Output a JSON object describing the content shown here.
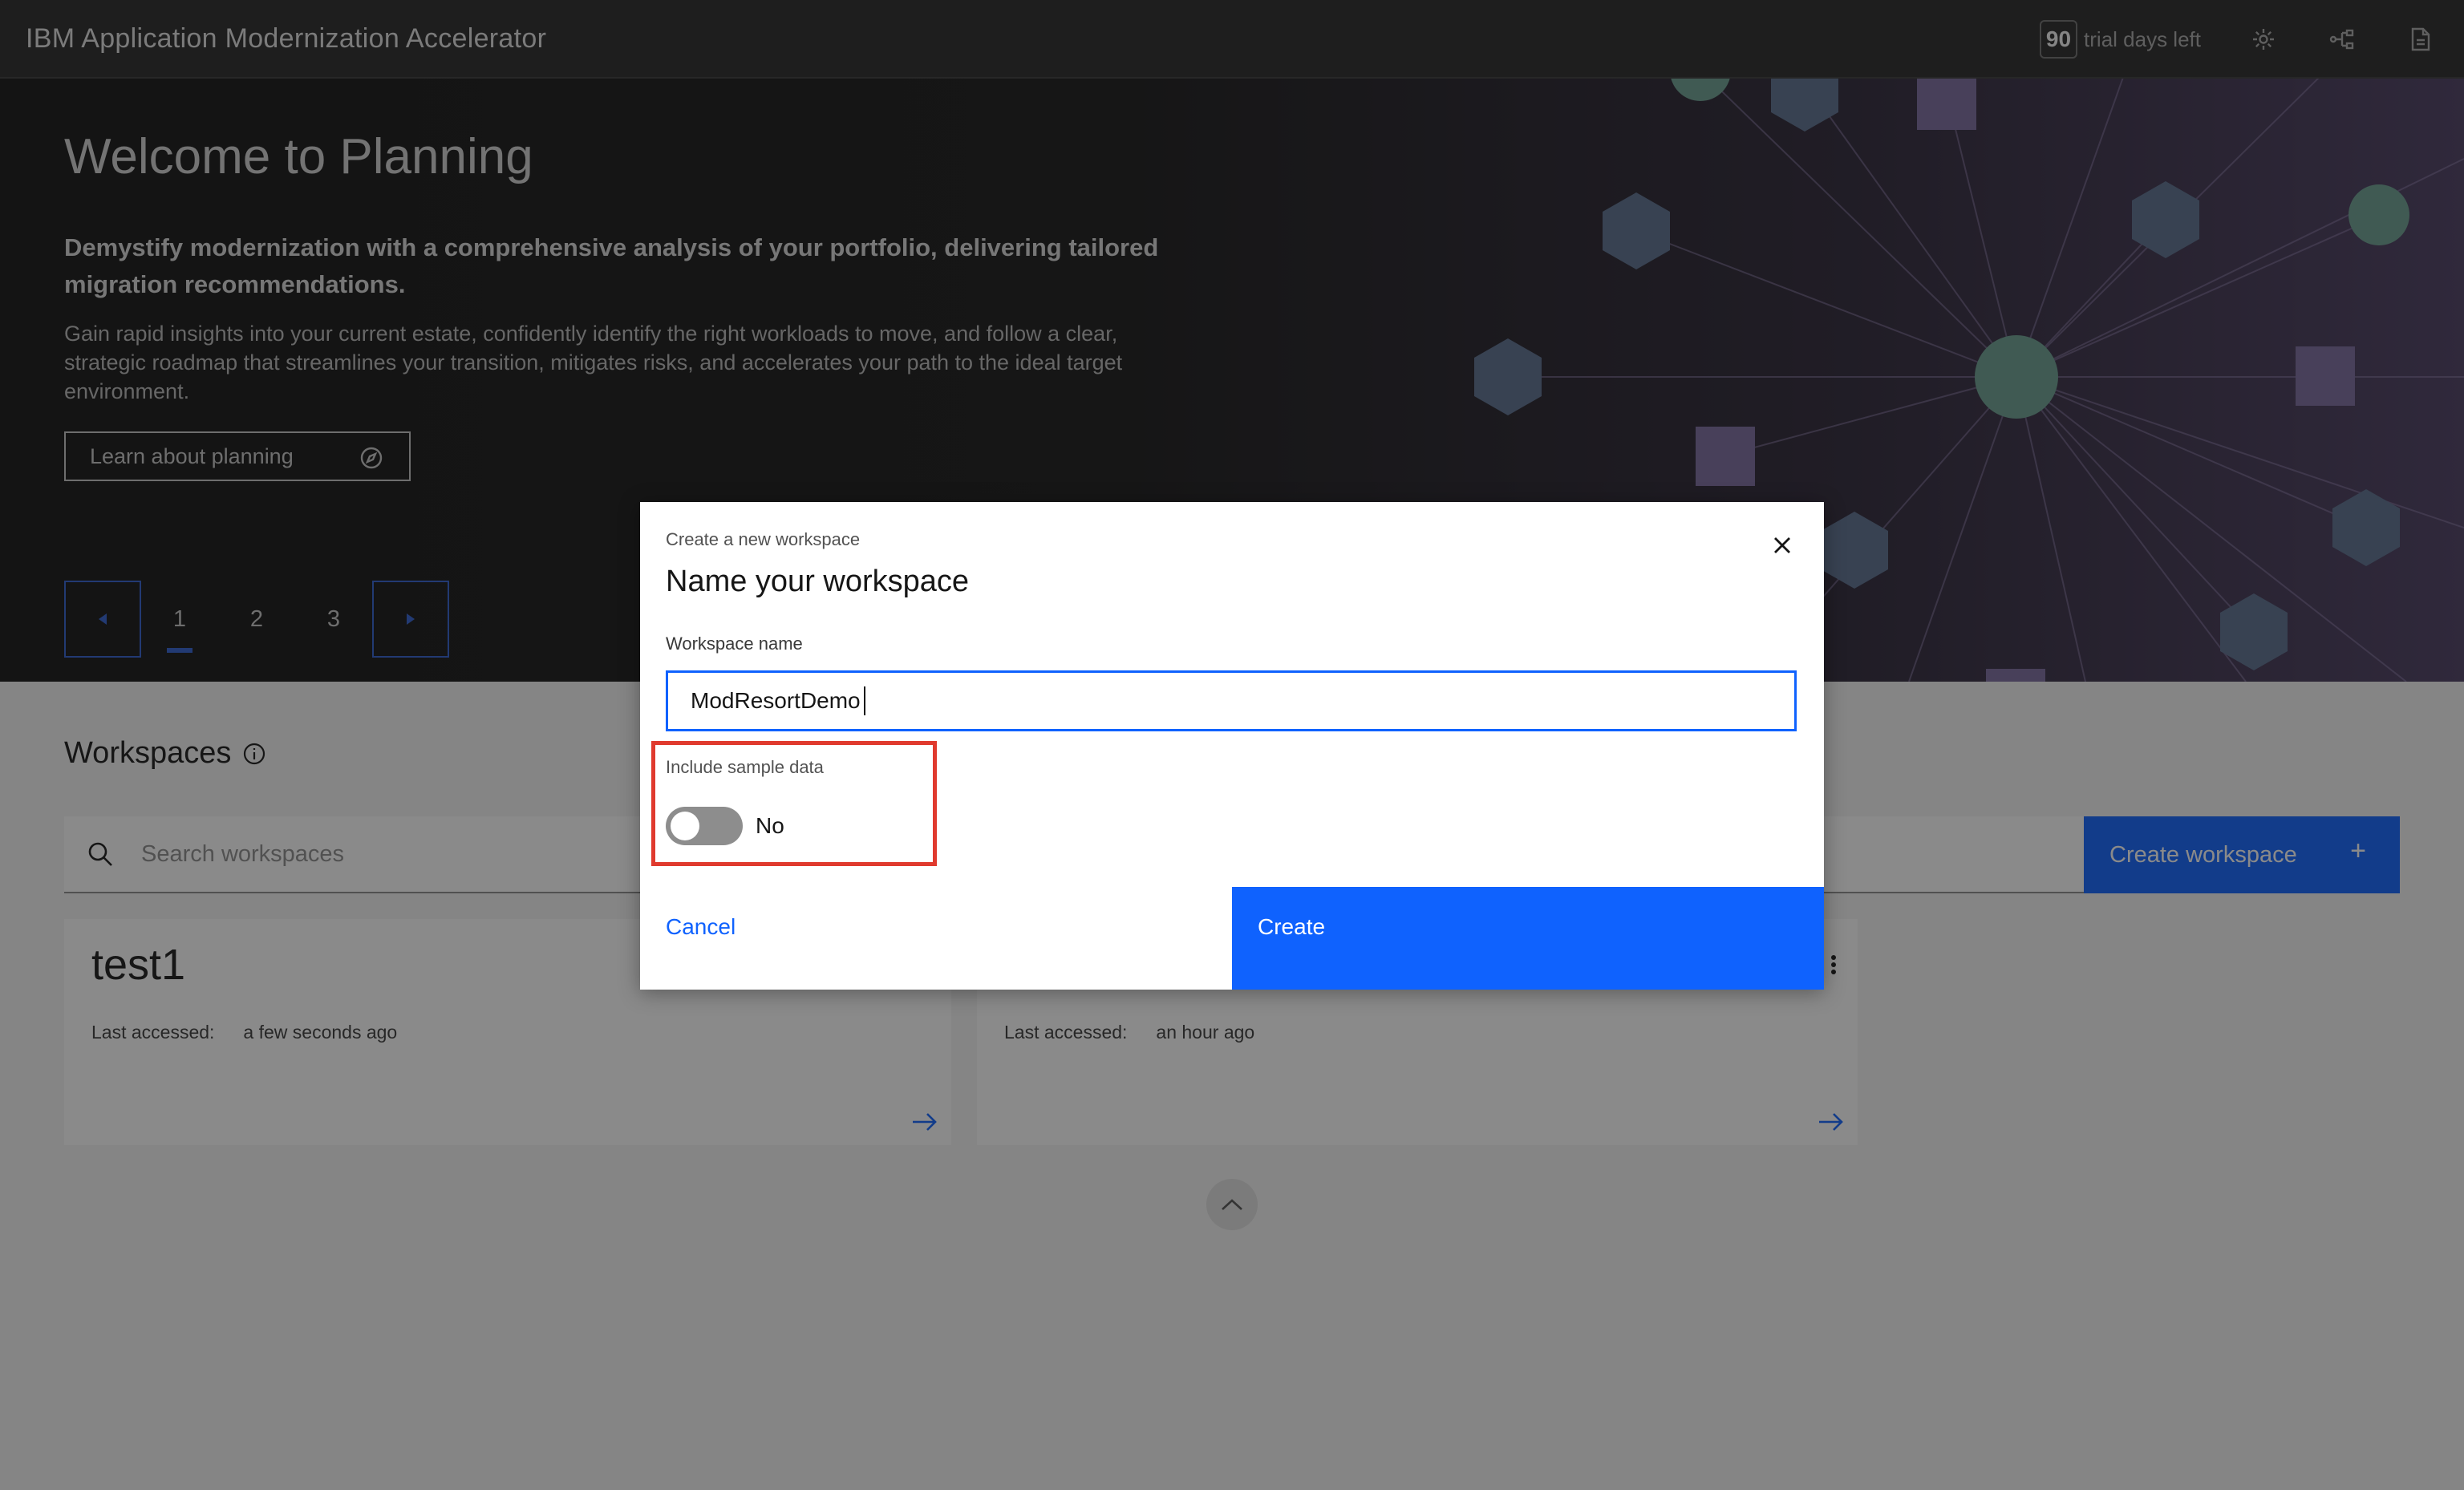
{
  "header": {
    "app_title": "IBM Application Modernization Accelerator",
    "trial_days": "90",
    "trial_text": "trial days left",
    "icons": [
      "settings-icon",
      "share-icon",
      "document-icon"
    ]
  },
  "hero": {
    "title": "Welcome to Planning",
    "lead": "Demystify modernization with a comprehensive analysis of your portfolio, delivering tailored migration recommendations.",
    "body": "Gain rapid insights into your current estate, confidently identify the right workloads to move, and follow a clear, strategic roadmap that streamlines your transition, mitigates risks, and accelerates your path to the ideal target environment.",
    "learn_button": "Learn about planning",
    "pager": {
      "pages": [
        "1",
        "2",
        "3"
      ],
      "current": "1"
    }
  },
  "workspaces": {
    "title": "Workspaces",
    "search_placeholder": "Search workspaces",
    "create_button": "Create workspace",
    "cards": [
      {
        "name": "test1",
        "last_accessed_label": "Last accessed:",
        "last_accessed": "a few seconds ago"
      },
      {
        "name": "",
        "last_accessed_label": "Last accessed:",
        "last_accessed": "an hour ago"
      }
    ]
  },
  "modal": {
    "label": "Create a new workspace",
    "heading": "Name your workspace",
    "field_label": "Workspace name",
    "field_value": "ModResortDemo",
    "sample_label": "Include sample data",
    "toggle_state": "No",
    "cancel": "Cancel",
    "create": "Create"
  },
  "colors": {
    "primary": "#0f62fe",
    "highlight": "#e03a2e",
    "header_bg": "#262626"
  }
}
